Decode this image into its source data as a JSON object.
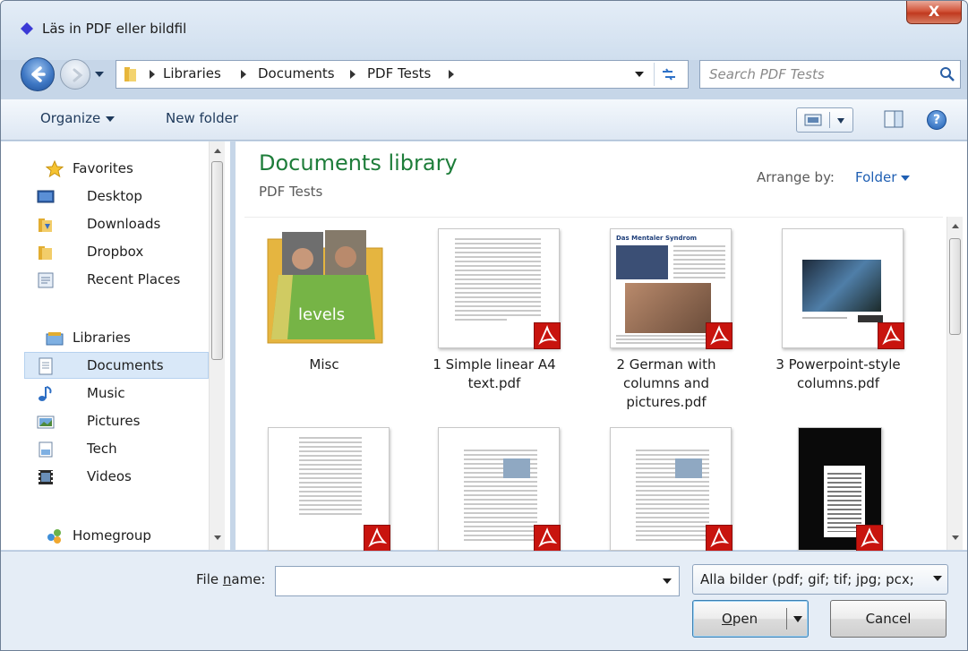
{
  "window": {
    "title": "Läs in PDF eller bildfil",
    "close_label": "X"
  },
  "address_bar": {
    "breadcrumbs": [
      "Libraries",
      "Documents",
      "PDF Tests"
    ]
  },
  "search": {
    "placeholder": "Search PDF Tests"
  },
  "toolbar": {
    "organize_label": "Organize",
    "new_folder_label": "New folder",
    "help_label": "?"
  },
  "nav_pane": {
    "favorites_header": "Favorites",
    "favorites": [
      "Desktop",
      "Downloads",
      "Dropbox",
      "Recent Places"
    ],
    "libraries_header": "Libraries",
    "libraries": [
      "Documents",
      "Music",
      "Pictures",
      "Tech",
      "Videos"
    ],
    "homegroup": "Homegroup",
    "selected": "Documents"
  },
  "content": {
    "title": "Documents library",
    "subtitle": "PDF Tests",
    "arrange_label": "Arrange by:",
    "arrange_value": "Folder",
    "items": [
      {
        "caption": "Misc",
        "kind": "folder",
        "folder_text": "levels"
      },
      {
        "caption": "1 Simple linear A4 text.pdf",
        "kind": "pdf"
      },
      {
        "caption": "2 German with columns and pictures.pdf",
        "kind": "pdf",
        "headline": "Das Mentaler Syndrom"
      },
      {
        "caption": "3 Powerpoint-style columns.pdf",
        "kind": "pdf"
      },
      {
        "caption": "",
        "kind": "pdf"
      },
      {
        "caption": "",
        "kind": "pdf"
      },
      {
        "caption": "",
        "kind": "pdf"
      },
      {
        "caption": "",
        "kind": "pdf"
      }
    ]
  },
  "bottom": {
    "file_name_label_prefix": "File ",
    "file_name_label_accel": "n",
    "file_name_label_suffix": "ame:",
    "file_name_value": "",
    "filter": "Alla bilder (pdf; gif; tif; jpg; pcx;",
    "open_accel": "O",
    "open_rest": "pen",
    "cancel_label": "Cancel"
  },
  "colors": {
    "library_title": "#1e7d3a",
    "link": "#1f5fb3",
    "pdf_badge": "#c8140e"
  }
}
